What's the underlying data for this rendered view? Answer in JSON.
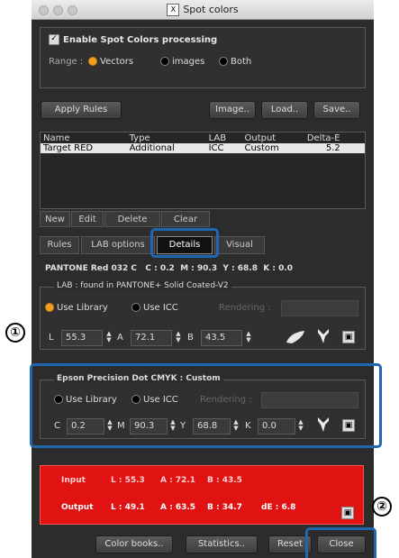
{
  "window": {
    "title": "Spot colors"
  },
  "enable": {
    "label": "Enable Spot Colors processing",
    "checked": true
  },
  "range": {
    "label": "Range :",
    "options": [
      "Vectors",
      "images",
      "Both"
    ],
    "selected": "Vectors"
  },
  "toolbar": {
    "apply_rules": "Apply Rules",
    "image": "Image..",
    "load": "Load..",
    "save": "Save.."
  },
  "rules_table": {
    "headers": [
      "Name",
      "Type",
      "LAB",
      "Output",
      "Delta-E"
    ],
    "rows": [
      [
        "Target RED",
        "Additional",
        "ICC",
        "Custom",
        "5.2"
      ]
    ]
  },
  "rule_actions": {
    "new": "New",
    "edit": "Edit",
    "delete": "Delete",
    "clear": "Clear"
  },
  "tabs": {
    "rules": "Rules",
    "lab_options": "LAB options",
    "details": "Details",
    "visual": "Visual",
    "active": "Details"
  },
  "pantone_line": "PANTONE Red 032 C   C : 0.2  M : 90.3  Y : 68.8  K : 0.0",
  "lab": {
    "group_title": "LAB : found in PANTONE+ Solid Coated-V2",
    "use_library": "Use Library",
    "use_icc": "Use ICC",
    "rendering": "Rendering :",
    "selected": "Use Library",
    "L": "55.3",
    "A": "72.1",
    "B": "43.5",
    "L_label": "L",
    "A_label": "A",
    "B_label": "B"
  },
  "cmyk": {
    "group_title": "Epson Precision Dot CMYK : Custom",
    "use_library": "Use Library",
    "use_icc": "Use ICC",
    "rendering": "Rendering :",
    "C": "0.2",
    "M": "90.3",
    "Y": "68.8",
    "K": "0.0",
    "C_label": "C",
    "M_label": "M",
    "Y_label": "Y",
    "K_label": "K"
  },
  "compare": {
    "input_label": "Input",
    "input_L": "L : 55.3",
    "input_A": "A : 72.1",
    "input_B": "B : 43.5",
    "output_label": "Output",
    "output_L": "L : 49.1",
    "output_A": "A : 63.5",
    "output_B": "B : 34.7",
    "output_dE": "dE : 6.8"
  },
  "footer": {
    "color_books": "Color books..",
    "statistics": "Statistics..",
    "reset": "Reset",
    "close": "Close"
  },
  "callouts": {
    "one": "①",
    "two": "②"
  },
  "colors": {
    "highlight": "#1f67b1",
    "panel_red": "#e01212",
    "radio_on": "#f0a020"
  }
}
